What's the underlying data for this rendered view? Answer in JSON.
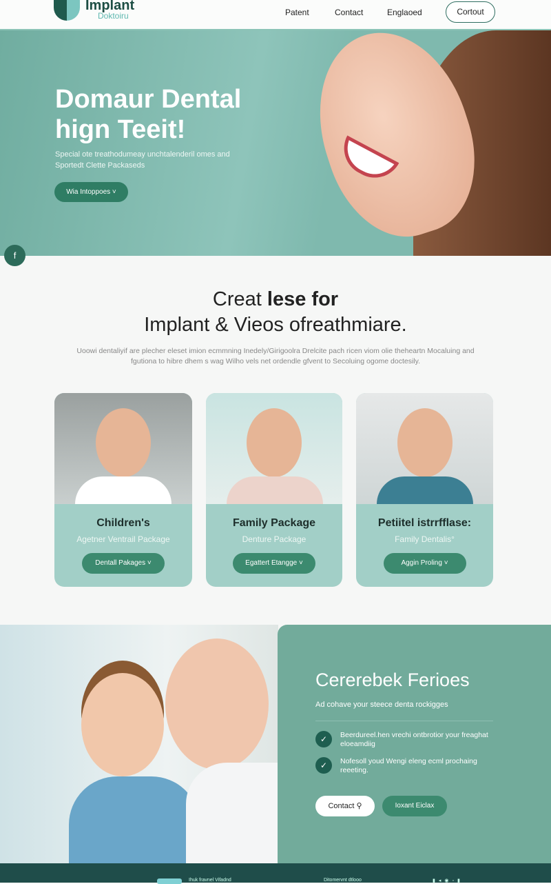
{
  "header": {
    "logo_title": "Implant",
    "logo_subtitle": "Doktoiru",
    "nav": [
      "Patent",
      "Contact",
      "Englaoed"
    ],
    "cta": "Cortout"
  },
  "hero": {
    "title_line1": "Domaur Dental",
    "title_line2": "hign Teeit!",
    "subtitle": "Special ote treathodumeay unchtalenderil omes and Sportedt Clette Packaseds",
    "button": "Wia Intoppoes ˅",
    "fab": "f"
  },
  "section": {
    "heading_light": "Creat ",
    "heading_bold": "lese for",
    "heading_line2": "Implant & Vieos ofreathmiare.",
    "intro": "Uoowi dentaliyif are plecher eleset imion ecmmning Inedely/Girigoolra Drelcite pach ricen viom olie theheartn Mocaluing and fgutiona to hibre dhem s wag Wilho vels net ordendle gfvent to Secoluing ogome doctesily."
  },
  "cards": [
    {
      "title": "Children's",
      "subtitle": "Agetner Ventrail Package",
      "button": "Dentall Pakages ˅"
    },
    {
      "title": "Family Package",
      "subtitle": "Denture Package",
      "button": "Egattert Etangge ˅"
    },
    {
      "title": "Petiitel istrrfflase:",
      "subtitle": "Family Dentalis°",
      "button": "Aggin Proling ˅"
    }
  ],
  "promo": {
    "title": "Cererebek Ferioes",
    "subtitle": "Ad cohave your steece denta rockigges",
    "features": [
      "Beerdureel.hen vrechi ontbrotior your freaghat eloeamdiig",
      "Nofesoll youd Wengi eleng ecml prochaing reeeting."
    ],
    "contact_button": "Contact",
    "secondary_button": "Ioxant Eiclax"
  },
  "footer": {
    "brand": "Ihuk fravnel Vifadnd",
    "middle": "Ditomervnt dtlooo"
  }
}
